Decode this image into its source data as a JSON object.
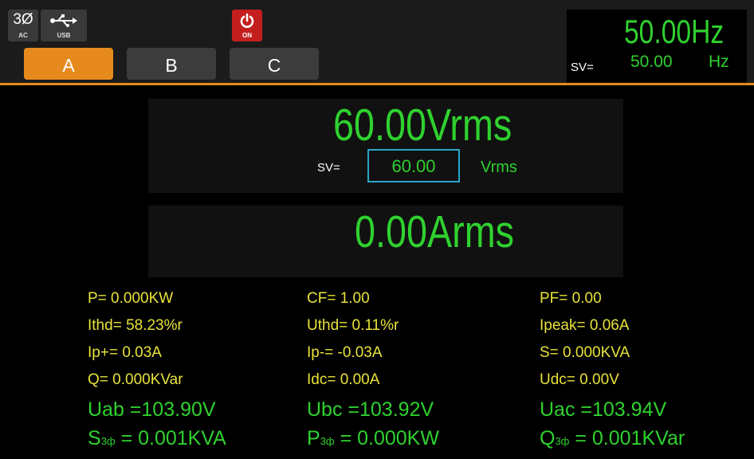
{
  "status": {
    "phase": {
      "glyph": "3Ø",
      "label": "AC"
    },
    "usb": {
      "glyph": "⇆",
      "label": "USB"
    },
    "power": {
      "label": "ON"
    }
  },
  "tabs": [
    {
      "label": "A",
      "active": true
    },
    {
      "label": "B",
      "active": false
    },
    {
      "label": "C",
      "active": false
    }
  ],
  "frequency": {
    "value": "50.00",
    "unit": "Hz",
    "sv_label": "SV=",
    "sv_value": "50.00",
    "sv_unit": "Hz"
  },
  "voltage": {
    "value": "60.00",
    "unit": "Vrms",
    "sv_label": "SV=",
    "sv_value": "60.00",
    "sv_unit": "Vrms"
  },
  "current": {
    "value": "0.00",
    "unit": "Arms"
  },
  "measurements": {
    "col1": [
      "P= 0.000KW",
      "Ithd= 58.23%r",
      "Ip+= 0.03A",
      "Q= 0.000KVar"
    ],
    "col2": [
      "CF= 1.00",
      "Uthd= 0.11%r",
      "Ip-= -0.03A",
      "Idc= 0.00A"
    ],
    "col3": [
      "PF= 0.00",
      "Ipeak= 0.06A",
      "S= 0.000KVA",
      "Udc= 0.00V"
    ]
  },
  "line_voltages": {
    "uab": "Uab =103.90V",
    "ubc": "Ubc =103.92V",
    "uac": "Uac =103.94V"
  },
  "totals": {
    "s": {
      "sym": "S",
      "sub": "3ф",
      "value": "= 0.001KVA"
    },
    "p": {
      "sym": "P",
      "sub": "3ф",
      "value": "= 0.000KW"
    },
    "q": {
      "sym": "Q",
      "sub": "3ф",
      "value": "= 0.001KVar"
    }
  },
  "colors": {
    "accent": "#e68a1e",
    "value_green": "#2fd12f",
    "label_yellow": "#e8e23a",
    "power_red": "#c41f1f",
    "box_blue": "#2aa7c9"
  }
}
